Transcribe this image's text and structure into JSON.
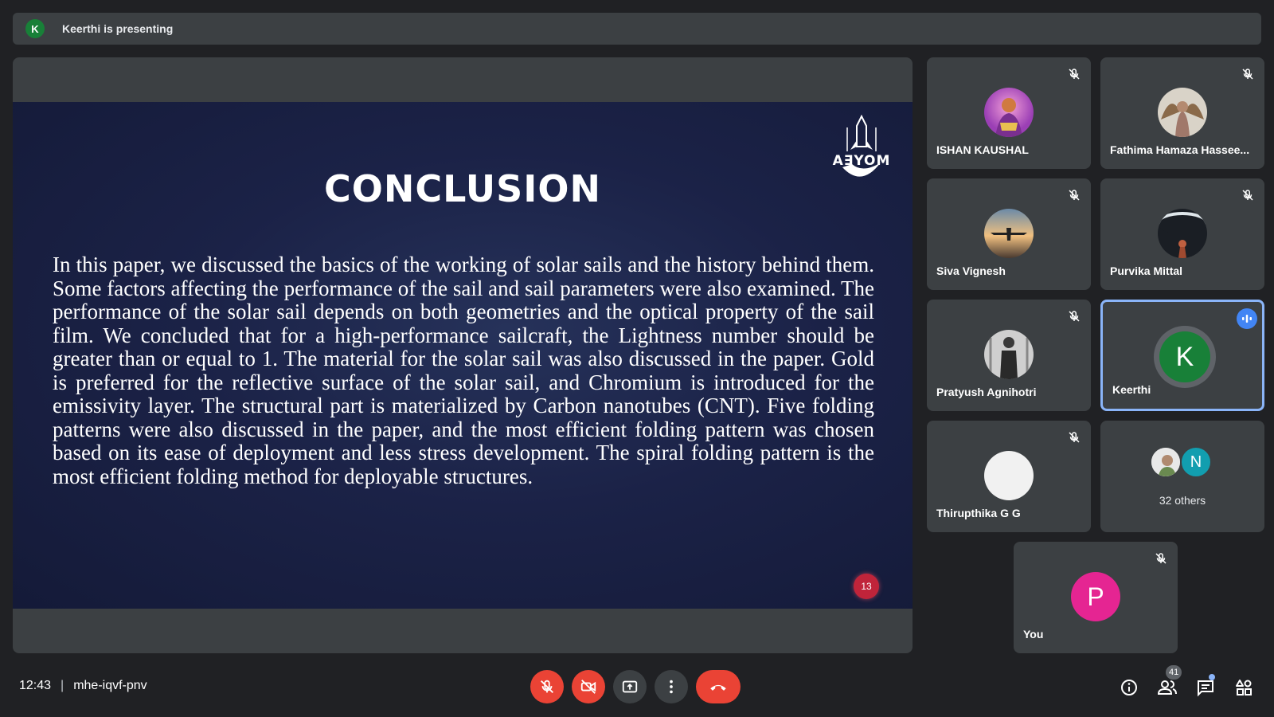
{
  "presenting": {
    "avatar_letter": "K",
    "text": "Keerthi is presenting"
  },
  "slide": {
    "title": "CONCLUSION",
    "logo_text": "A∃YOM",
    "body": "In this paper, we discussed the basics of the working of solar sails and the history behind them. Some factors affecting the performance of the sail and sail parameters were also examined. The performance of the solar sail depends on both geometries and the optical property of the sail film. We concluded that for a high-performance sailcraft, the Lightness number should be greater than or equal to 1. The material for the solar sail was also discussed in the paper. Gold is preferred for the reflective surface of the solar sail, and Chromium is introduced for the emissivity layer. The structural part is materialized by Carbon nanotubes (CNT). Five folding patterns were also discussed in the paper, and the most efficient folding pattern was chosen based on its ease of deployment and less stress development. The spiral folding pattern is the most efficient folding method for deployable structures.",
    "page_number": "13"
  },
  "participants": [
    {
      "name": "ISHAN KAUSHAL",
      "muted": true
    },
    {
      "name": "Fathima Hamaza Hassee...",
      "muted": true
    },
    {
      "name": "Siva Vignesh",
      "muted": true
    },
    {
      "name": "Purvika Mittal",
      "muted": true
    },
    {
      "name": "Pratyush Agnihotri",
      "muted": true
    },
    {
      "name": "Keerthi",
      "avatar_letter": "K",
      "speaking": true
    },
    {
      "name": "Thirupthika G G",
      "muted": true
    }
  ],
  "others": {
    "label": "32 others",
    "avatar_letter": "N"
  },
  "self": {
    "name": "You",
    "avatar_letter": "P",
    "muted": true
  },
  "meeting": {
    "time": "12:43",
    "separator": "|",
    "code": "mhe-iqvf-pnv"
  },
  "people_count": "41",
  "colors": {
    "end_call": "#ea4335",
    "accent": "#8ab4f8",
    "keerthi": "#188038",
    "self": "#e52592"
  }
}
